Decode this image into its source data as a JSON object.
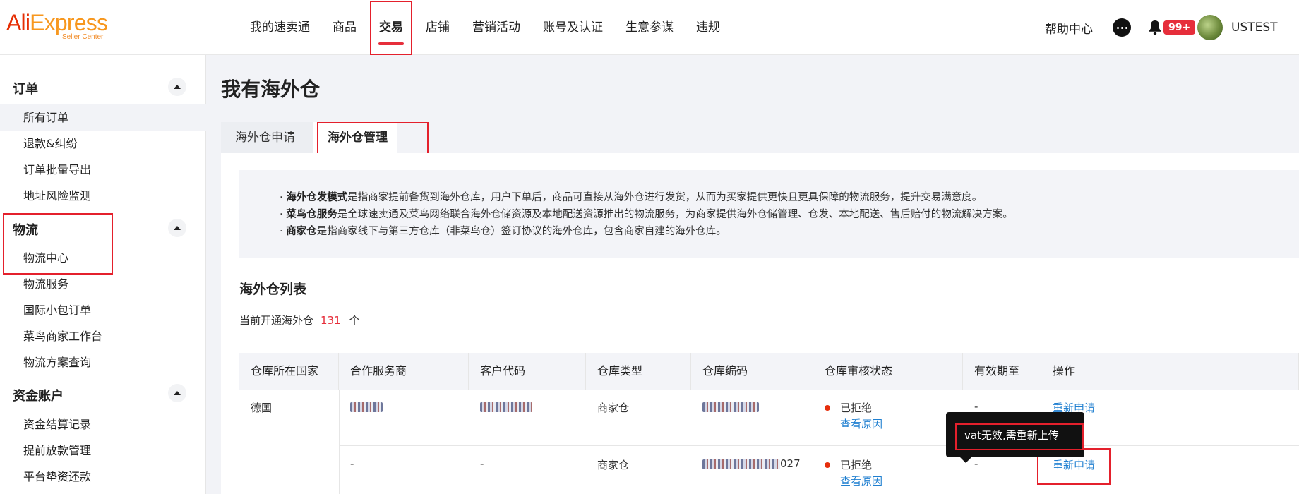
{
  "logo": {
    "brand_part1": "Ali",
    "brand_part2": "Express",
    "sub": "Seller Center"
  },
  "topnav": [
    "我的速卖通",
    "商品",
    "交易",
    "店铺",
    "营销活动",
    "账号及认证",
    "生意参谋",
    "违规"
  ],
  "topnav_active": "交易",
  "header": {
    "help": "帮助中心",
    "badge": "99+",
    "username": "USTEST"
  },
  "sidebar": {
    "groups": [
      {
        "title": "订单",
        "items": [
          "所有订单",
          "退款&纠纷",
          "订单批量导出",
          "地址风险监测"
        ]
      },
      {
        "title": "物流",
        "items": [
          "物流中心",
          "物流服务",
          "国际小包订单",
          "菜鸟商家工作台",
          "物流方案查询"
        ]
      },
      {
        "title": "资金账户",
        "items": [
          "资金结算记录",
          "提前放款管理",
          "平台垫资还款"
        ]
      }
    ],
    "selected": "所有订单"
  },
  "page": {
    "title": "我有海外仓",
    "tabs": [
      "海外仓申请",
      "海外仓管理"
    ],
    "active_tab": "海外仓管理"
  },
  "info": {
    "lines": [
      {
        "prefix": "· ",
        "bold": "海外仓发模式",
        "rest": "是指商家提前备货到海外仓库，用户下单后，商品可直接从海外仓进行发货，从而为买家提供更快且更具保障的物流服务，提升交易满意度。"
      },
      {
        "prefix": "· ",
        "bold": "菜鸟仓服务",
        "rest": "是全球速卖通及菜鸟网络联合海外仓储资源及本地配送资源推出的物流服务，为商家提供海外仓储管理、仓发、本地配送、售后赔付的物流解决方案。"
      },
      {
        "prefix": "· ",
        "bold": "商家仓",
        "rest": "是指商家线下与第三方仓库（非菜鸟仓）签订协议的海外仓库，包含商家自建的海外仓库。"
      }
    ]
  },
  "list": {
    "title": "海外仓列表",
    "count_label": "当前开通海外仓",
    "count": "131",
    "count_unit": "个",
    "columns": [
      "仓库所在国家",
      "合作服务商",
      "客户代码",
      "仓库类型",
      "仓库编码",
      "仓库审核状态",
      "有效期至",
      "操作"
    ],
    "rows": [
      {
        "country": "德国",
        "provider": "",
        "client_code": "",
        "type": "商家仓",
        "code": "",
        "status": "已拒绝",
        "reason_link": "查看原因",
        "valid_until": "-",
        "action": "重新申请"
      },
      {
        "country": "",
        "provider": "-",
        "client_code": "-",
        "type": "商家仓",
        "code_suffix": "027",
        "status": "已拒绝",
        "reason_link": "查看原因",
        "valid_until": "-",
        "action": "重新申请"
      }
    ]
  },
  "tooltip": {
    "text": "vat无效,需重新上传"
  },
  "colors": {
    "brand_red": "#e62e04",
    "accent_red": "#e62e3b",
    "link_blue": "#1f7fd0",
    "status_dot": "#e62e0c"
  }
}
